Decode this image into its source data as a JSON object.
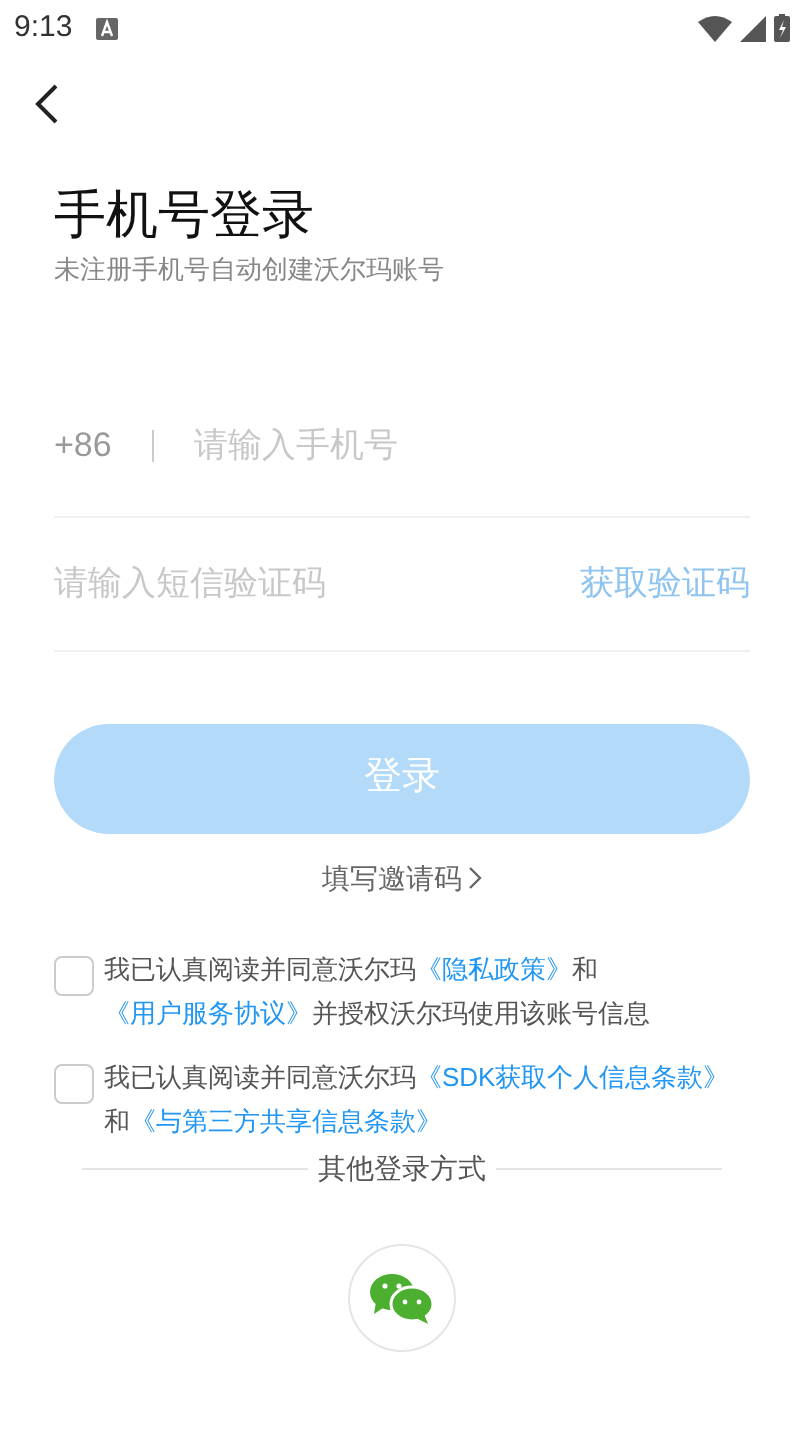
{
  "status_bar": {
    "time": "9:13"
  },
  "title": "手机号登录",
  "subtitle": "未注册手机号自动创建沃尔玛账号",
  "phone_field": {
    "country_code": "+86",
    "placeholder": "请输入手机号"
  },
  "code_field": {
    "placeholder": "请输入短信验证码",
    "action": "获取验证码",
    "disabled": true
  },
  "login_button": {
    "label": "登录",
    "disabled": true
  },
  "invite_link": "填写邀请码",
  "agreements": [
    {
      "checked": false,
      "segments": [
        {
          "kind": "text",
          "text": "我已认真阅读并同意沃尔玛"
        },
        {
          "kind": "link",
          "text": "《隐私政策》"
        },
        {
          "kind": "text",
          "text": "和"
        },
        {
          "kind": "link",
          "text": "《用户服务协议》"
        },
        {
          "kind": "text",
          "text": "并授权沃尔玛使用该账号信息"
        }
      ]
    },
    {
      "checked": false,
      "segments": [
        {
          "kind": "text",
          "text": "我已认真阅读并同意沃尔玛"
        },
        {
          "kind": "link",
          "text": "《SDK获取个人信息条款》"
        },
        {
          "kind": "text",
          "text": "和"
        },
        {
          "kind": "link",
          "text": "《与第三方共享信息条款》"
        }
      ]
    }
  ],
  "other_login": {
    "label": "其他登录方式"
  }
}
